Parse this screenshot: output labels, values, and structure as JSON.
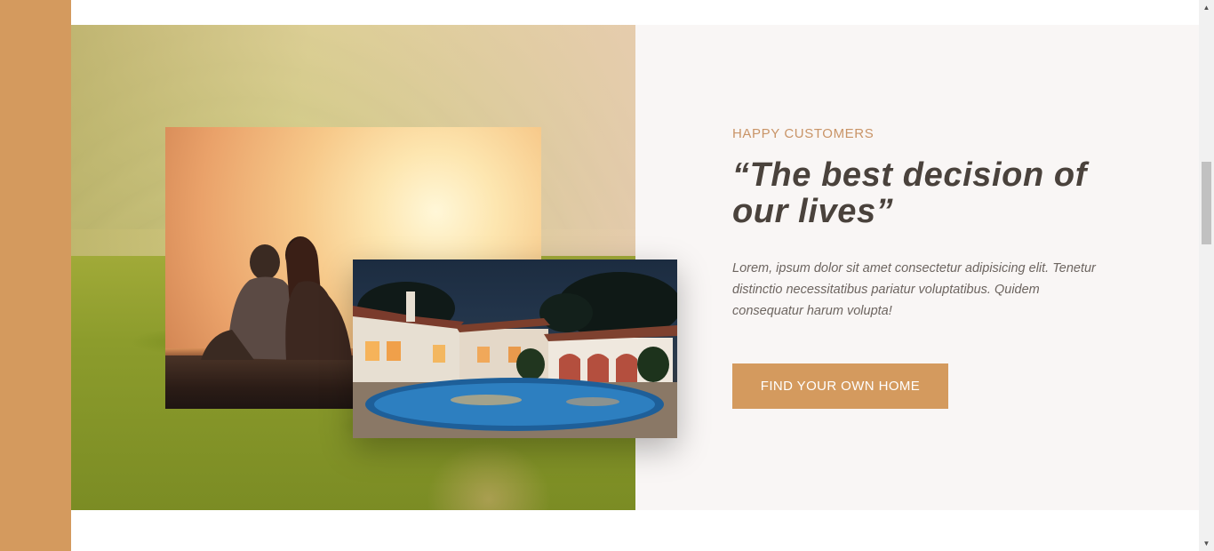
{
  "testimonial": {
    "eyebrow": "HAPPY CUSTOMERS",
    "quote": "“The best decision of our lives”",
    "body": "Lorem, ipsum dolor sit amet consectetur adipisicing elit. Tenetur distinctio necessitatibus pariatur voluptatibus. Quidem consequatur harum volupta!",
    "cta_label": "FIND YOUR OWN HOME"
  },
  "colors": {
    "accent": "#d49a5e",
    "eyebrow": "#c99467",
    "heading": "#4a423c",
    "body_text": "#6d6560",
    "section_bg": "#f9f6f5"
  },
  "scrollbar": {
    "up_icon": "▲",
    "down_icon": "▼"
  }
}
